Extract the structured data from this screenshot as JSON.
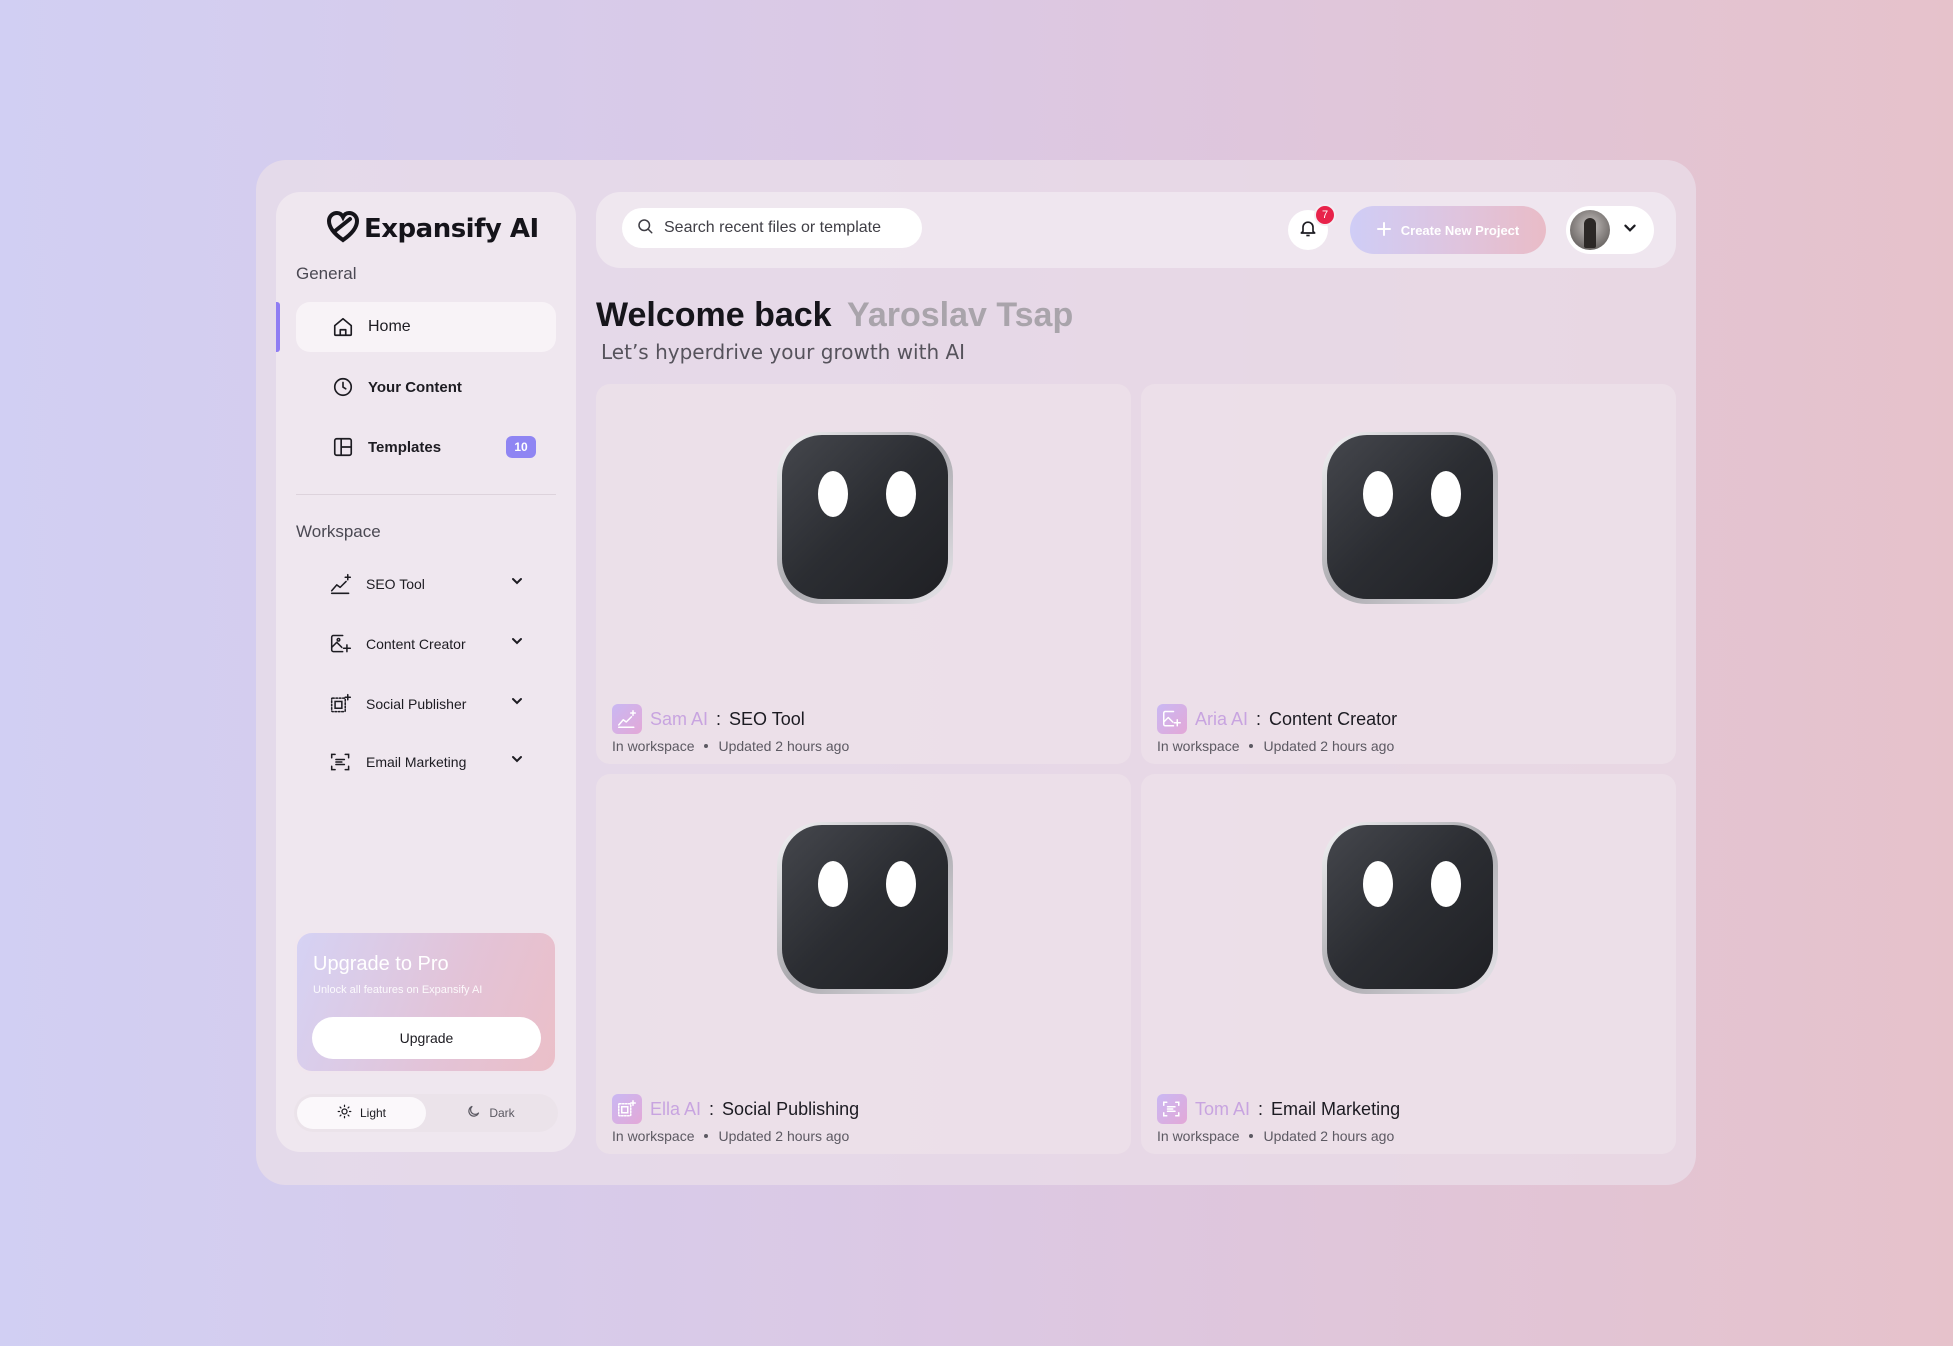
{
  "brand": {
    "name": "Expansify AI"
  },
  "sidebar": {
    "general_label": "General",
    "nav": [
      {
        "label": "Home",
        "icon": "home-icon",
        "active": true
      },
      {
        "label": "Your Content",
        "icon": "clock-icon"
      },
      {
        "label": "Templates",
        "icon": "layout-icon",
        "badge": "10"
      }
    ],
    "workspace_label": "Workspace",
    "workspace": [
      {
        "label": "SEO Tool",
        "icon": "chart-sparkle-icon"
      },
      {
        "label": "Content Creator",
        "icon": "image-sparkle-icon"
      },
      {
        "label": "Social Publisher",
        "icon": "frame-sparkle-icon"
      },
      {
        "label": "Email Marketing",
        "icon": "scan-text-icon"
      }
    ],
    "upgrade": {
      "title": "Upgrade to Pro",
      "subtitle": "Unlock all features on Expansify AI",
      "button": "Upgrade"
    },
    "theme": {
      "light": "Light",
      "dark": "Dark",
      "selected": "Light"
    }
  },
  "topbar": {
    "search_placeholder": "Search recent files or template",
    "notifications_count": "7",
    "create_button": "Create New Project"
  },
  "main": {
    "welcome": "Welcome back",
    "user_name": "Yaroslav Tsap",
    "subtitle": "Let’s hyperdrive your growth with AI",
    "cards": [
      {
        "ai_name": "Sam AI",
        "separator": " : ",
        "title": "SEO Tool",
        "location": "In workspace",
        "updated": "Updated 2 hours ago",
        "icon": "chart-sparkle-icon"
      },
      {
        "ai_name": "Aria AI",
        "separator": " : ",
        "title": "Content Creator",
        "location": "In workspace",
        "updated": "Updated 2 hours ago",
        "icon": "image-sparkle-icon"
      },
      {
        "ai_name": "Ella AI",
        "separator": " : ",
        "title": "Social Publishing",
        "location": "In workspace",
        "updated": "Updated 2 hours ago",
        "icon": "frame-sparkle-icon"
      },
      {
        "ai_name": "Tom AI",
        "separator": " : ",
        "title": "Email Marketing",
        "location": "In workspace",
        "updated": "Updated 2 hours ago",
        "icon": "scan-text-icon"
      }
    ]
  },
  "colors": {
    "accent": "#8f7df3",
    "badge_red": "#e8224a",
    "ai_name": "#c8a4e0"
  }
}
